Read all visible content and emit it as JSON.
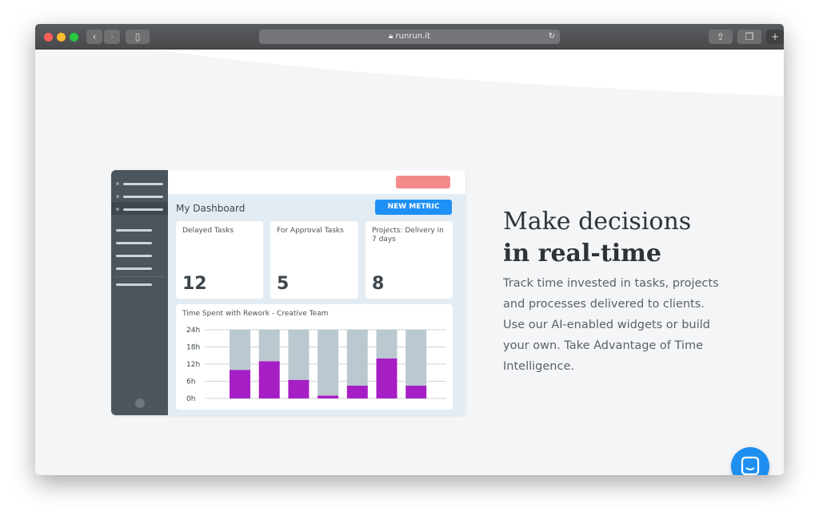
{
  "browser": {
    "url": "runrun.it"
  },
  "dashboard": {
    "title": "My Dashboard",
    "new_metric": "NEW METRIC",
    "cards": [
      {
        "label": "Delayed Tasks",
        "value": "12"
      },
      {
        "label": "For Approval Tasks",
        "value": "5"
      },
      {
        "label": "Projects: Delivery in 7 days",
        "value": "8"
      }
    ],
    "chart_title": "Time Spent with Rework - Creative Team"
  },
  "chart_data": {
    "type": "bar",
    "stacked": true,
    "title": "Time Spent with Rework - Creative Team",
    "yticks": [
      "24h",
      "18h",
      "12h",
      "6h",
      "0h"
    ],
    "ylim": [
      0,
      24
    ],
    "grid": true,
    "series": [
      {
        "color": "#a61fc4",
        "values": [
          10,
          13,
          6.5,
          1,
          4.5,
          14,
          4.5
        ]
      },
      {
        "color": "#b9c9cf",
        "values": [
          14,
          11,
          17.5,
          23,
          19.5,
          10,
          19.5
        ]
      }
    ]
  },
  "hero": {
    "title_line1": "Make decisions",
    "title_line2": "in real-time",
    "body": "Track time invested in tasks, projects and processes delivered to clients. Use our AI-enabled widgets or build your own. Take Advantage of Time Intelligence."
  },
  "colors": {
    "accent": "#2196f3",
    "purple": "#a61fc4",
    "sidebar": "#4b555b"
  }
}
